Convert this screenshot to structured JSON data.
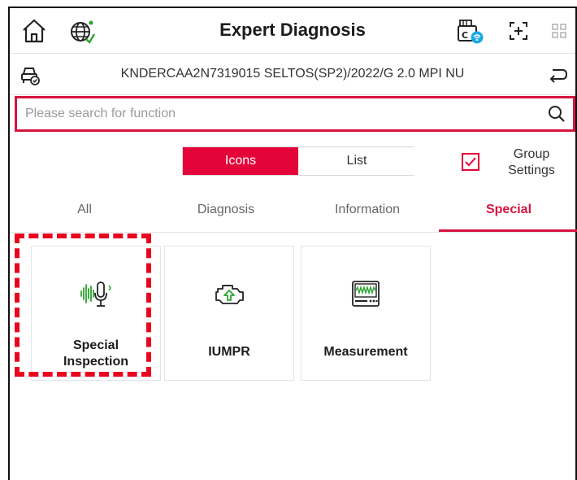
{
  "header": {
    "title": "Expert Diagnosis",
    "icons": [
      "home-icon",
      "globe-icon",
      "vci-connection-icon",
      "screenshot-icon",
      "grid-icon"
    ]
  },
  "vehicle": {
    "vin_text": "KNDERCAA2N7319015 SELTOS(SP2)/2022/G 2.0 MPI NU"
  },
  "search": {
    "placeholder": "Please search for function",
    "value": ""
  },
  "view_toggle": {
    "icons_label": "Icons",
    "list_label": "List",
    "selected": "Icons"
  },
  "group_settings": {
    "line1": "Group",
    "line2": "Settings",
    "checked": true
  },
  "tabs": [
    {
      "label": "All"
    },
    {
      "label": "Diagnosis"
    },
    {
      "label": "Information"
    },
    {
      "label": "Special"
    }
  ],
  "active_tab": "Special",
  "tiles": [
    {
      "label_line1": "Special",
      "label_line2": "Inspection",
      "icon": "voice-waveform-icon"
    },
    {
      "label_line1": "IUMPR",
      "label_line2": "",
      "icon": "engine-icon"
    },
    {
      "label_line1": "Measurement",
      "label_line2": "",
      "icon": "oscilloscope-icon"
    }
  ],
  "colors": {
    "accent": "#e4043a",
    "active_tab": "#d6153f",
    "highlight": "#e8061e",
    "inspection_icon": "#2aa32e"
  }
}
